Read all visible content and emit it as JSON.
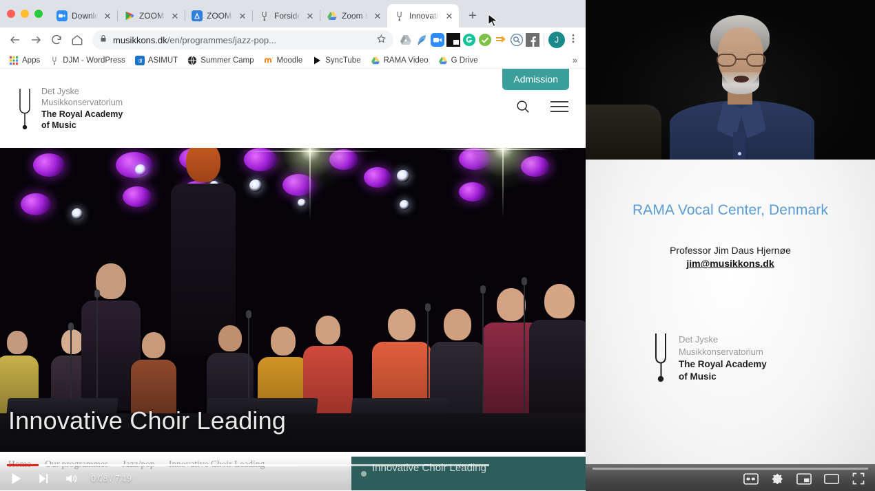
{
  "browser": {
    "window_buttons": [
      "close",
      "minimize",
      "maximize"
    ],
    "tabs": [
      {
        "label": "Download",
        "icon": "zoom-icon",
        "active": false
      },
      {
        "label": "ZOOM Cl",
        "icon": "play-store-icon",
        "active": false
      },
      {
        "label": "ZOOM Cl",
        "icon": "app-store-icon",
        "active": false
      },
      {
        "label": "Forside -",
        "icon": "tuning-fork-icon",
        "active": false
      },
      {
        "label": "Zoom set",
        "icon": "google-drive-icon",
        "active": false
      },
      {
        "label": "Innovativ",
        "icon": "tuning-fork-icon",
        "active": true
      }
    ],
    "new_tab_label": "+",
    "close_label": "✕",
    "toolbar": {
      "back_label": "Back",
      "forward_label": "Forward",
      "reload_label": "Reload",
      "home_label": "Home",
      "url_domain": "musikkons.dk",
      "url_path": "/en/programmes/jazz-pop...",
      "url_full": "musikkons.dk/en/programmes/jazz-pop...",
      "lock_label": "Secure",
      "star_label": "Bookmark this page",
      "avatar_initial": "J",
      "menu_label": "Customize and control Google Chrome",
      "extensions": [
        "drive-extension-icon",
        "quill-extension-icon",
        "zoom-extension-icon",
        "picture-in-picture-icon",
        "grammarly-icon",
        "checkmark-extension-icon",
        "arrow-extension-icon",
        "search-extension-icon",
        "facebook-icon"
      ]
    },
    "bookmarks": [
      {
        "label": "Apps",
        "icon": "apps-grid-icon"
      },
      {
        "label": "DJM - WordPress",
        "icon": "tuning-fork-icon"
      },
      {
        "label": "ASIMUT",
        "icon": "asimut-icon"
      },
      {
        "label": "Summer Camp",
        "icon": "globe-icon"
      },
      {
        "label": "Moodle",
        "icon": "moodle-icon"
      },
      {
        "label": "SyncTube",
        "icon": "play-triangle-icon"
      },
      {
        "label": "RAMA Video",
        "icon": "google-drive-icon"
      },
      {
        "label": "G Drive",
        "icon": "google-drive-icon"
      }
    ],
    "bookmarks_overflow_label": "»"
  },
  "site": {
    "admission_button": "Admission",
    "logo": {
      "line1": "Det Jyske",
      "line2": "Musikkonservatorium",
      "line3": "The Royal Academy",
      "line4": "of Music"
    },
    "search_label": "Search",
    "menu_label": "Menu",
    "hero_title": "Innovative Choir Leading",
    "breadcrumb": "Home → Our programmes → Jazz/pop → Innovative Choir Leading"
  },
  "player": {
    "play_label": "Play",
    "next_label": "Next",
    "volume_label": "Mute",
    "current_time": "0:08",
    "separator": " / ",
    "duration": "7:19",
    "time_display": "0:08 / 7:19",
    "progress_percent": 6.5,
    "buffered_percent": 60,
    "up_next_title": "Innovative Choir Leading",
    "progress_color": "#e62117",
    "panel_color": "#2d5e5c"
  },
  "zoom_meeting": {
    "webcam_label": "speaker-video",
    "slide": {
      "title": "RAMA Vocal Center, Denmark",
      "title_color": "#5b9bd5",
      "presenter": "Professor Jim Daus Hjernøe",
      "email": "jim@musikkons.dk",
      "logo": {
        "line1": "Det Jyske",
        "line2": "Musikkonservatorium",
        "line3": "The Royal Academy",
        "line4": "of Music"
      }
    },
    "controls": [
      {
        "name": "closed-captions-button",
        "label": "CC"
      },
      {
        "name": "settings-button",
        "label": "Settings"
      },
      {
        "name": "miniplayer-button",
        "label": "Miniplayer"
      },
      {
        "name": "theater-mode-button",
        "label": "Theater mode"
      },
      {
        "name": "fullscreen-button",
        "label": "Full screen"
      }
    ]
  }
}
